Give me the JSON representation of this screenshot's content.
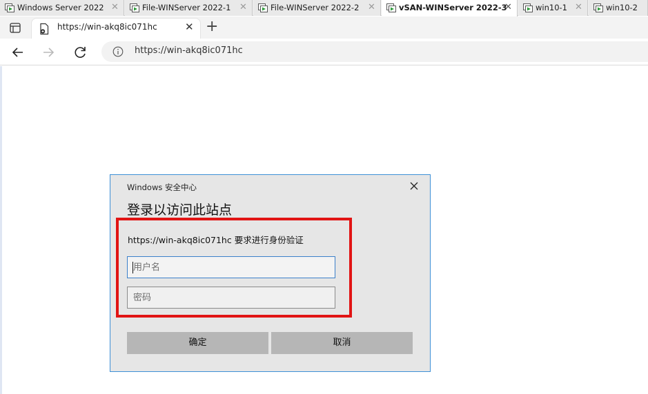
{
  "vm_tabs": [
    {
      "label": "Windows Server 2022",
      "active": false
    },
    {
      "label": "File-WINServer 2022-1",
      "active": false
    },
    {
      "label": "File-WINServer 2022-2",
      "active": false
    },
    {
      "label": "vSAN-WINServer 2022-3",
      "active": true
    },
    {
      "label": "win10-1",
      "active": false
    },
    {
      "label": "win10-2",
      "active": false
    }
  ],
  "browser": {
    "tab_title": "https://win-akq8ic071hc",
    "address": "https://win-akq8ic071hc",
    "icons": {
      "tab_actions": "tab-actions-icon",
      "page": "document-icon",
      "close": "close-icon",
      "new_tab": "plus-icon",
      "back": "back-arrow-icon",
      "forward": "forward-arrow-icon",
      "refresh": "refresh-icon",
      "info": "info-icon"
    }
  },
  "dialog": {
    "caption": "Windows 安全中心",
    "heading": "登录以访问此站点",
    "message": "https://win-akq8ic071hc 要求进行身份验证",
    "username_placeholder": "用户名",
    "username_value": "",
    "password_placeholder": "密码",
    "password_value": "",
    "ok_label": "确定",
    "cancel_label": "取消"
  },
  "colors": {
    "highlight_box": "#e11414",
    "dialog_border": "#3c8fd6",
    "dialog_bg": "#e6e6e6",
    "button_bg": "#b6b6b6"
  }
}
